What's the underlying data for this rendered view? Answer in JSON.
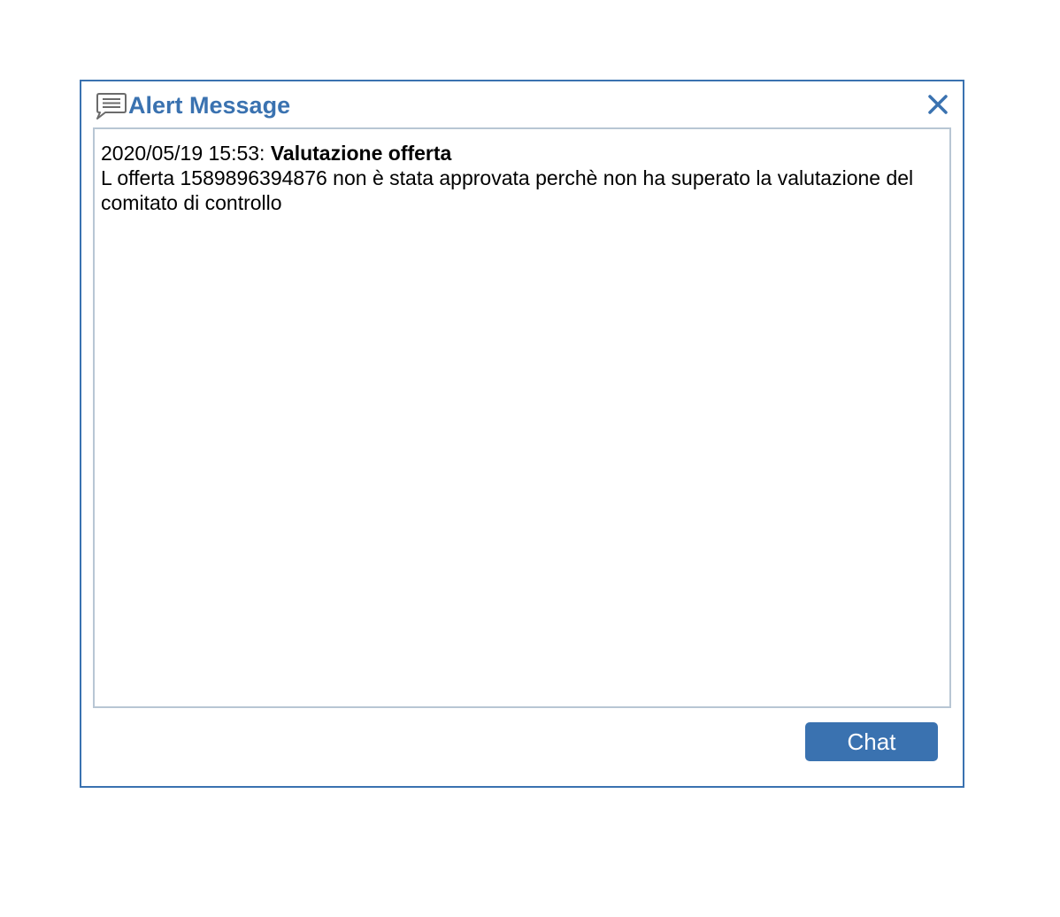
{
  "dialog": {
    "title": "Alert Message",
    "title_icon": "chat-bubble-icon",
    "close_icon": "close-icon",
    "accent_color": "#3a72b0"
  },
  "message": {
    "timestamp": "2020/05/19 15:53:",
    "subject": "Valutazione offerta",
    "body": "L offerta 1589896394876 non è stata approvata perchè non ha superato la valutazione del comitato di controllo"
  },
  "actions": {
    "chat_label": "Chat"
  }
}
